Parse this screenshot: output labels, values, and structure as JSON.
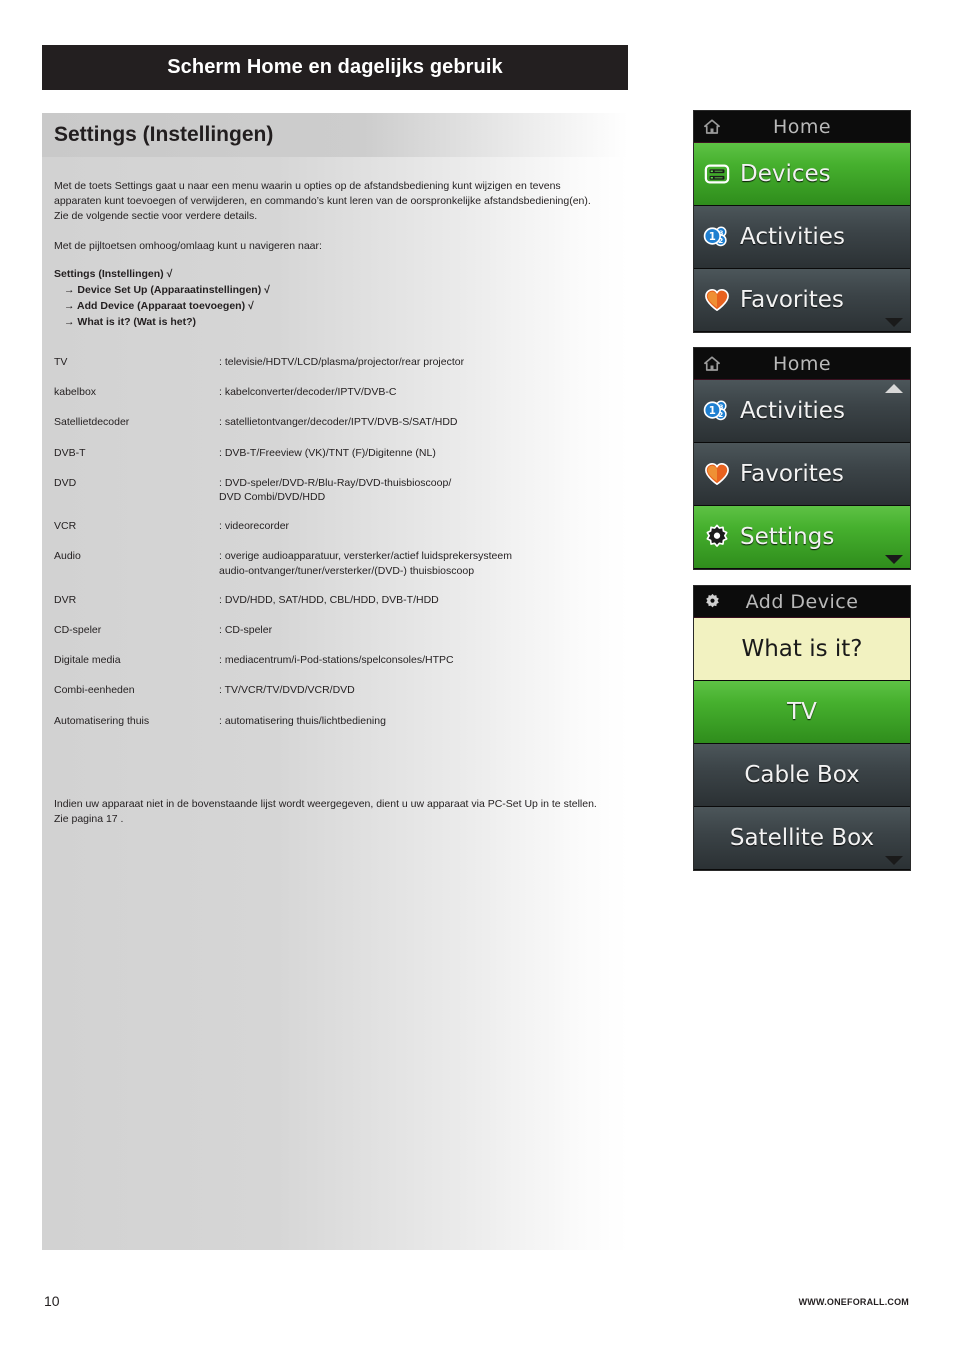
{
  "page": {
    "header_title": "Scherm Home en dagelijks gebruik",
    "section_heading": "Settings (Instellingen)",
    "page_number": "10",
    "website": "WWW.ONEFORALL.COM"
  },
  "body": {
    "intro": "Met de toets Settings gaat u naar een menu waarin u opties op de afstandsbediening kunt wijzigen en tevens apparaten kunt toevoegen of verwijderen, en commando’s kunt leren van de oorspronkelijke afstandsbediening(en). Zie de volgende sectie voor verdere details.",
    "nav_intro": "Met de pijltoetsen omhoog/omlaag kunt u navigeren naar:",
    "nav_list": [
      "Settings (Instellingen) √",
      "→ Device Set Up (Apparaatinstellingen) √",
      "→ Add Device (Apparaat toevoegen) √",
      "→ What is it? (Wat is het?)"
    ],
    "closing": "Indien uw apparaat niet in de bovenstaande lijst wordt weergegeven, dient u uw apparaat via PC-Set Up in te stellen. Zie pagina 17 ."
  },
  "device_table": [
    {
      "name": "TV",
      "desc": ": televisie/HDTV/LCD/plasma/projector/rear projector"
    },
    {
      "name": "kabelbox",
      "desc": ": kabelconverter/decoder/IPTV/DVB-C"
    },
    {
      "name": "Satellietdecoder",
      "desc": ": satellietontvanger/decoder/IPTV/DVB-S/SAT/HDD"
    },
    {
      "name": "DVB-T",
      "desc": ": DVB-T/Freeview (VK)/TNT (F)/Digitenne (NL)"
    },
    {
      "name": "DVD",
      "desc": ": DVD-speler/DVD-R/Blu-Ray/DVD-thuisbioscoop/\n  DVD Combi/DVD/HDD"
    },
    {
      "name": "VCR",
      "desc": ": videorecorder"
    },
    {
      "name": "Audio",
      "desc": ": overige audioapparatuur, versterker/actief luidsprekersysteem\n  audio-ontvanger/tuner/versterker/(DVD-) thuisbioscoop"
    },
    {
      "name": "DVR",
      "desc": ": DVD/HDD, SAT/HDD, CBL/HDD, DVB-T/HDD"
    },
    {
      "name": "CD-speler",
      "desc": ": CD-speler"
    },
    {
      "name": "Digitale media",
      "desc": ": mediacentrum/i-Pod-stations/spelconsoles/HTPC"
    },
    {
      "name": "Combi-eenheden",
      "desc": ": TV/VCR/TV/DVD/VCR/DVD"
    },
    {
      "name": "Automatisering thuis",
      "desc": ": automatisering thuis/lichtbediening"
    }
  ],
  "screens": [
    {
      "id": "home-devices",
      "header": {
        "title": "Home",
        "icon": "home-icon"
      },
      "rows": [
        {
          "label": "Devices",
          "icon": "devices-icon",
          "state": "selected"
        },
        {
          "label": "Activities",
          "icon": "activities-icon",
          "state": "normal"
        },
        {
          "label": "Favorites",
          "icon": "favorites-icon",
          "state": "normal"
        }
      ],
      "scroll_down": true,
      "scroll_up": false
    },
    {
      "id": "home-settings",
      "header": {
        "title": "Home",
        "icon": "home-icon"
      },
      "rows": [
        {
          "label": "Activities",
          "icon": "activities-icon",
          "state": "normal"
        },
        {
          "label": "Favorites",
          "icon": "favorites-icon",
          "state": "normal"
        },
        {
          "label": "Settings",
          "icon": "settings-icon",
          "state": "selected"
        }
      ],
      "scroll_down": true,
      "scroll_up": true
    },
    {
      "id": "add-device",
      "header": {
        "title": "Add Device",
        "icon": "gear-icon"
      },
      "rows": [
        {
          "label": "What is it?",
          "icon": "",
          "state": "highlight"
        },
        {
          "label": "TV",
          "icon": "",
          "state": "selected"
        },
        {
          "label": "Cable Box",
          "icon": "",
          "state": "normal"
        },
        {
          "label": "Satellite Box",
          "icon": "",
          "state": "normal"
        }
      ],
      "scroll_down": true,
      "scroll_up": false
    }
  ],
  "colors": {
    "header_bar": "#231f20",
    "selected_green": "#46b02e",
    "row_dark": "#3c4448",
    "highlight_yellow": "#f2f2c1",
    "screen_header": "#0c0c0c"
  }
}
